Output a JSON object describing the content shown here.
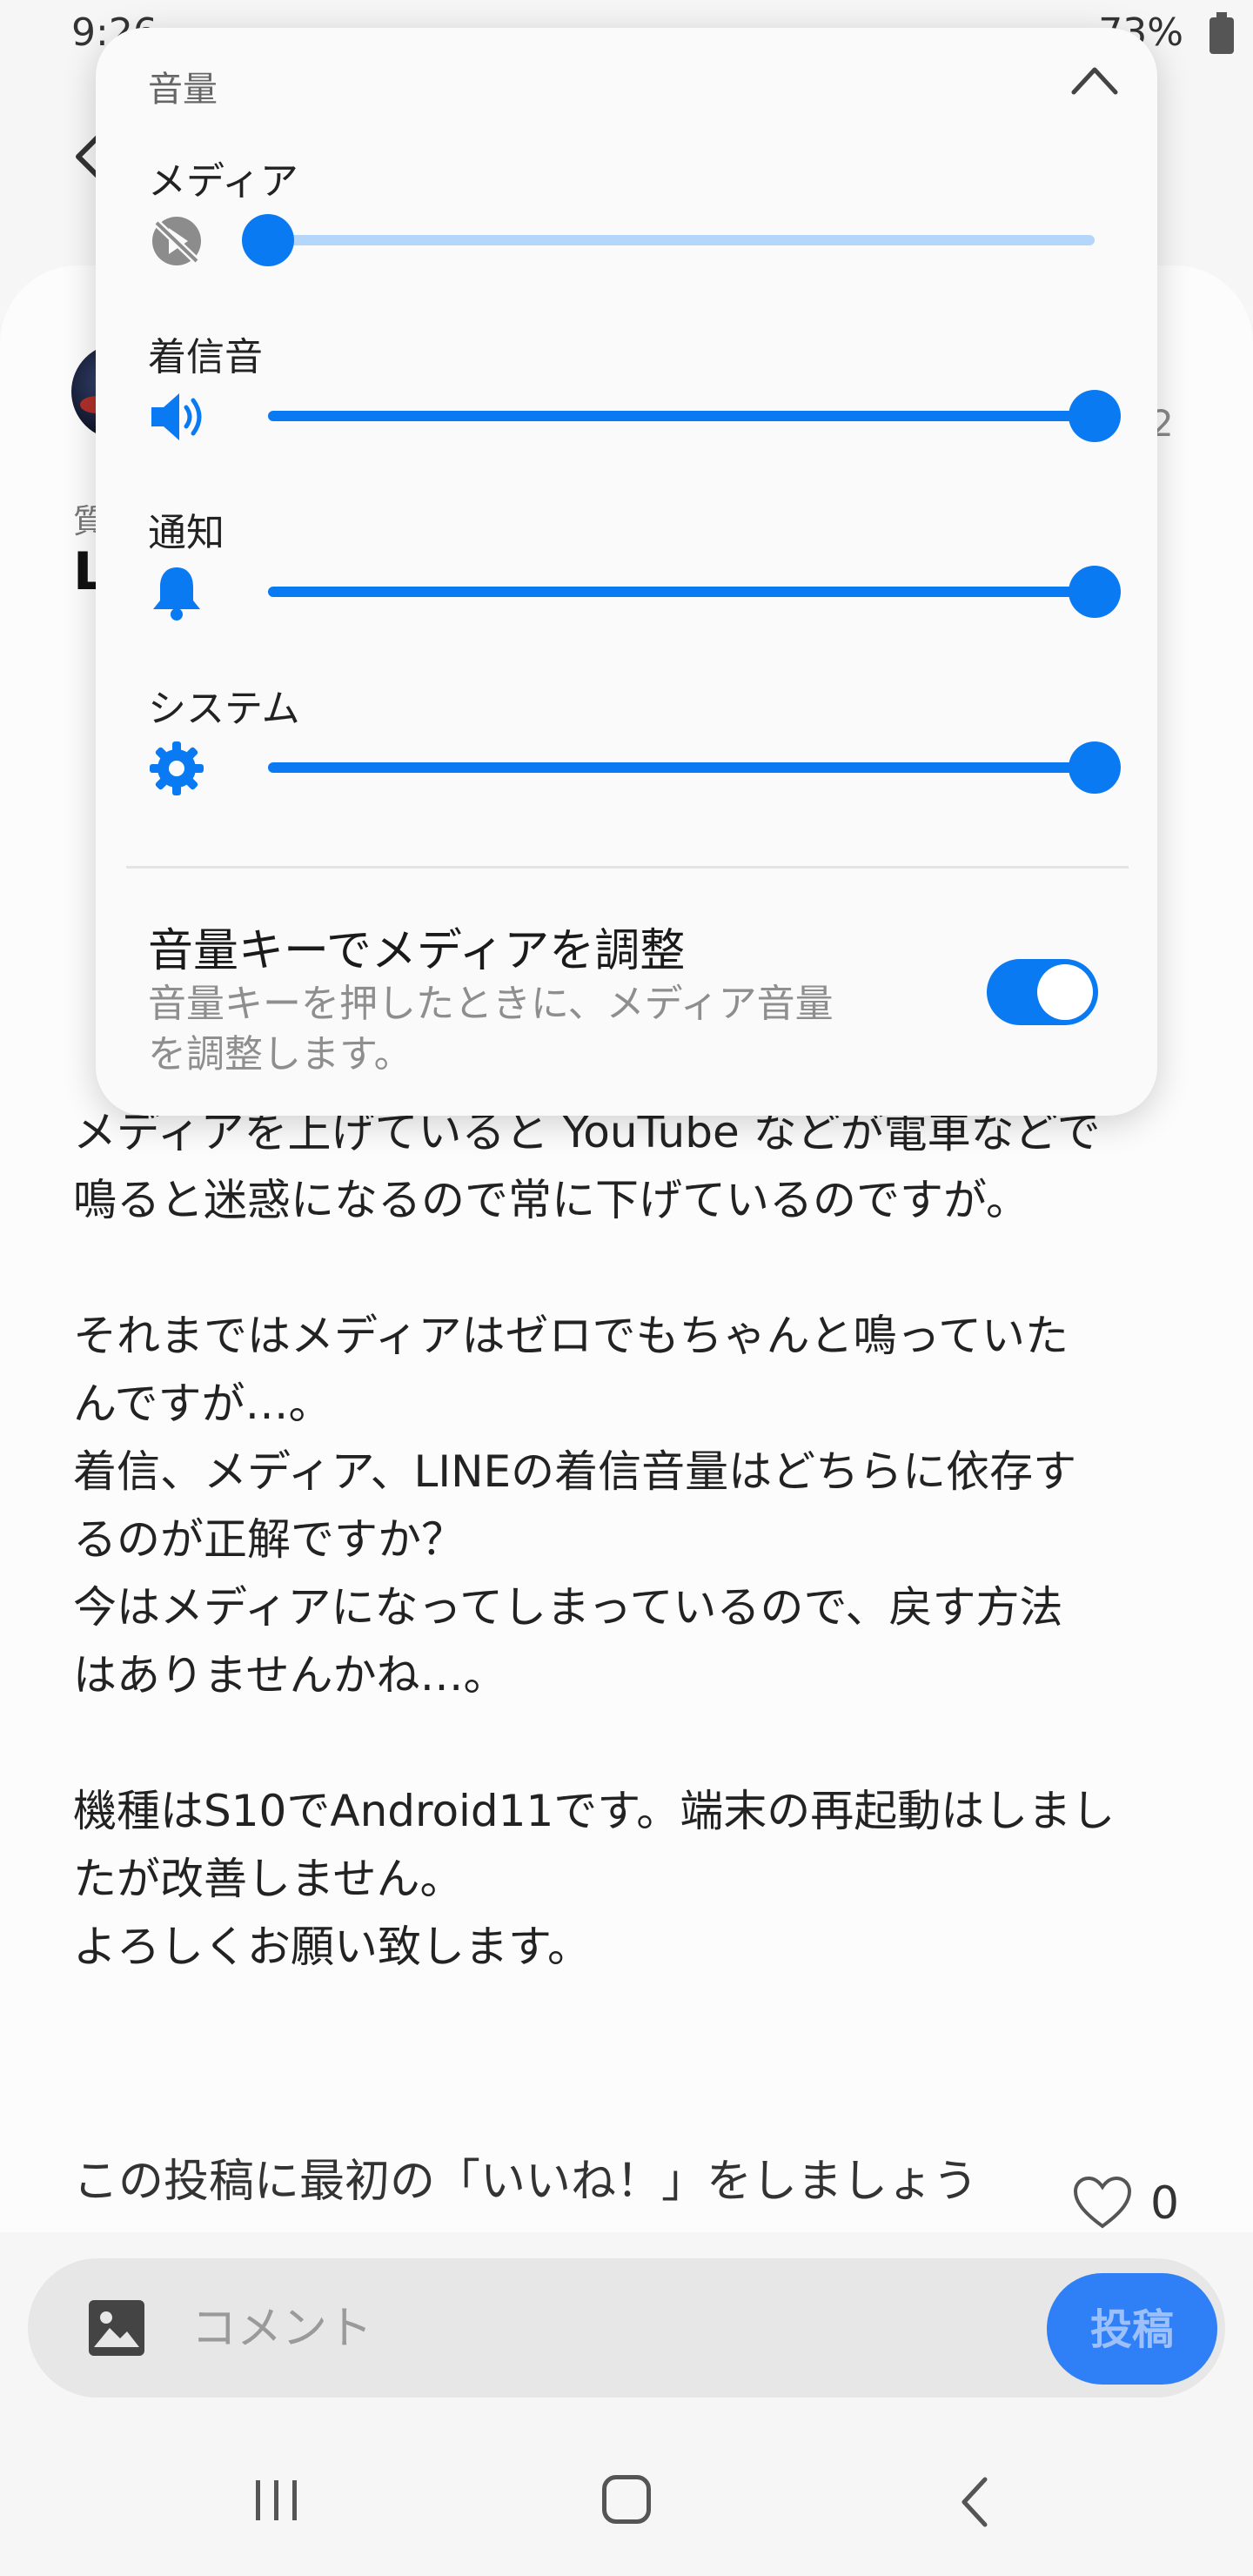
{
  "status_bar": {
    "time": "9:26",
    "battery": "73%"
  },
  "post": {
    "category_label": "質",
    "title_initial": "L",
    "side_number": "2",
    "body": [
      "メディアを上げていると YouTube などが電車などで\n鳴ると迷惑になるので常に下げているのですが。",
      "それまではメディアはゼロでもちゃんと鳴っていた\nんですが…。\n着信、メディア、LINEの着信音量はどちらに依存す\nるのが正解ですか？\n今はメディアになってしまっているので、戻す方法\nはありませんかね…。",
      "機種はS10でAndroid11です。端末の再起動はしまし\nたが改善しません。\nよろしくお願い致します。"
    ],
    "like_prompt": "この投稿に最初の「いいね！」をしましょう",
    "like_count": "0"
  },
  "comment_bar": {
    "placeholder": "コメント",
    "post_button": "投稿"
  },
  "volume_panel": {
    "title": "音量",
    "rows": [
      {
        "label": "メディア",
        "icon": "media-muted-icon",
        "level": 0.0
      },
      {
        "label": "着信音",
        "icon": "speaker-icon",
        "level": 1.0
      },
      {
        "label": "通知",
        "icon": "bell-icon",
        "level": 1.0
      },
      {
        "label": "システム",
        "icon": "gear-icon",
        "level": 1.0
      }
    ],
    "toggle": {
      "title": "音量キーでメディアを調整",
      "description": "音量キーを押したときに、メディア音量\nを調整します。",
      "enabled": true
    }
  },
  "colors": {
    "accent": "#0a7af3",
    "accent_light": "#b4d6fa",
    "post_button": "#2f7ff7"
  }
}
